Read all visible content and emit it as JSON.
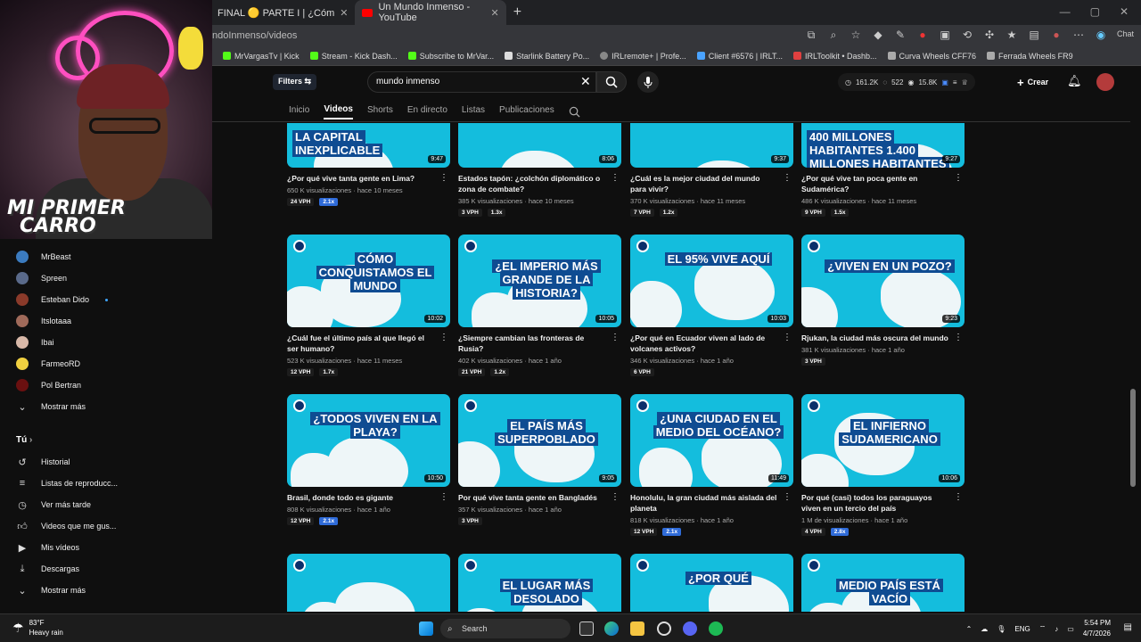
{
  "browser": {
    "tabs": [
      {
        "label": "FINAL 🟡 PARTE I | ¿Cóm",
        "close": "✕"
      },
      {
        "label": "Un Mundo Inmenso - YouTube",
        "close": "✕"
      }
    ],
    "new_tab": "+",
    "url": "ndoInmenso/videos",
    "chat_label": "Chat",
    "bookmarks": [
      "MrVargasTv | Kick",
      "Stream - Kick Dash...",
      "Subscribe to MrVar...",
      "Starlink Battery Po...",
      "IRLremote+ | Profe...",
      "Client #6576 | IRLT...",
      "IRLToolkit • Dashb...",
      "Curva Wheels CFF76",
      "Ferrada Wheels FR9"
    ]
  },
  "header": {
    "filters_label": "Filters",
    "search_value": "mundo inmenso",
    "clear": "✕",
    "stats": {
      "a": "161.2K",
      "b": "522",
      "c": "15.8K"
    },
    "create_label": "Crear"
  },
  "channel_tabs": [
    "Inicio",
    "Videos",
    "Shorts",
    "En directo",
    "Listas",
    "Publicaciones"
  ],
  "sidebar": {
    "subs": [
      {
        "label": "MrBeast",
        "color": "#3b7bbf"
      },
      {
        "label": "Spreen",
        "color": "#5a6a8a"
      },
      {
        "label": "Esteban Dido",
        "color": "#8a3a2a"
      },
      {
        "label": "Itslotaaa",
        "color": "#a06a5a"
      },
      {
        "label": "Ibai",
        "color": "#d8b8a8"
      },
      {
        "label": "FarmeoRD",
        "color": "#f0d040"
      },
      {
        "label": "Pol Bertran",
        "color": "#6a1010"
      }
    ],
    "show_more": "Mostrar más",
    "you_label": "Tú",
    "you_items": [
      "Historial",
      "Listas de reproducc...",
      "Ver más tarde",
      "Videos que me gus...",
      "Mis vídeos",
      "Descargas",
      "Mostrar más"
    ]
  },
  "webcam": {
    "overlay_line1": "MI PRIMER",
    "overlay_line2": "CARRO"
  },
  "videos": [
    {
      "thumb_text": "LA CAPITAL INEXPLICABLE",
      "duration": "9:47",
      "title": "¿Por qué vive tanta gente en Lima?",
      "views": "650 K visualizaciones",
      "age": "hace 10 meses",
      "chips": [
        "24 VPH",
        "2.1x"
      ],
      "blue": 1
    },
    {
      "thumb_text": "",
      "duration": "8:06",
      "title": "Estados tapón: ¿colchón diplomático o zona de combate?",
      "views": "385 K visualizaciones",
      "age": "hace 10 meses",
      "chips": [
        "3 VPH",
        "1.3x"
      ],
      "blue": -1
    },
    {
      "thumb_text": "",
      "duration": "9:37",
      "title": "¿Cuál es la mejor ciudad del mundo para vivir?",
      "views": "370 K visualizaciones",
      "age": "hace 11 meses",
      "chips": [
        "7 VPH",
        "1.2x"
      ],
      "blue": -1
    },
    {
      "thumb_text": "400 MILLONES HABITANTES    1.400 MILLONES HABITANTES",
      "duration": "9:27",
      "title": "¿Por qué vive tan poca gente en Sudamérica?",
      "views": "486 K visualizaciones",
      "age": "hace 11 meses",
      "chips": [
        "9 VPH",
        "1.5x"
      ],
      "blue": -1
    },
    {
      "thumb_text": "CÓMO CONQUISTAMOS EL MUNDO",
      "duration": "10:02",
      "title": "¿Cuál fue el último país al que llegó el ser humano?",
      "views": "523 K visualizaciones",
      "age": "hace 11 meses",
      "chips": [
        "12 VPH",
        "1.7x"
      ],
      "blue": -1
    },
    {
      "thumb_text": "¿EL IMPERIO MÁS GRANDE DE LA HISTORIA?",
      "duration": "10:05",
      "title": "¿Siempre cambian las fronteras de Rusia?",
      "views": "402 K visualizaciones",
      "age": "hace 1 año",
      "chips": [
        "21 VPH",
        "1.2x"
      ],
      "blue": -1
    },
    {
      "thumb_text": "EL 95% VIVE AQUÍ",
      "duration": "10:03",
      "title": "¿Por qué en Ecuador viven al lado de volcanes activos?",
      "views": "346 K visualizaciones",
      "age": "hace 1 año",
      "chips": [
        "6 VPH"
      ],
      "blue": -1
    },
    {
      "thumb_text": "¿VIVEN EN UN POZO?",
      "duration": "9:23",
      "title": "Rjukan, la ciudad más oscura del mundo",
      "views": "381 K visualizaciones",
      "age": "hace 1 año",
      "chips": [
        "3 VPH"
      ],
      "blue": -1
    },
    {
      "thumb_text": "¿TODOS VIVEN EN LA PLAYA?",
      "duration": "10:50",
      "title": "Brasil, donde todo es gigante",
      "views": "808 K visualizaciones",
      "age": "hace 1 año",
      "chips": [
        "12 VPH",
        "2.1x"
      ],
      "blue": 1
    },
    {
      "thumb_text": "EL PAÍS MÁS SUPERPOBLADO",
      "duration": "9:05",
      "title": "Por qué vive tanta gente en Bangladés",
      "views": "357 K visualizaciones",
      "age": "hace 1 año",
      "chips": [
        "3 VPH"
      ],
      "blue": -1
    },
    {
      "thumb_text": "¿UNA CIUDAD EN EL MEDIO DEL OCÉANO?",
      "duration": "11:49",
      "title": "Honolulu, la gran ciudad más aislada del planeta",
      "views": "818 K visualizaciones",
      "age": "hace 1 año",
      "chips": [
        "12 VPH",
        "2.1x"
      ],
      "blue": 1
    },
    {
      "thumb_text": "EL INFIERNO SUDAMERICANO",
      "duration": "10:06",
      "title": "Por qué (casi) todos los paraguayos viven en un tercio del país",
      "views": "1 M de visualizaciones",
      "age": "hace 1 año",
      "chips": [
        "4 VPH",
        "2.8x"
      ],
      "blue": 1
    },
    {
      "thumb_text": "",
      "duration": "",
      "title": "",
      "views": "",
      "age": "",
      "chips": [],
      "blue": -1
    },
    {
      "thumb_text": "EL LUGAR MÁS DESOLADO",
      "duration": "",
      "title": "",
      "views": "",
      "age": "",
      "chips": [],
      "blue": -1
    },
    {
      "thumb_text": "¿POR QUÉ",
      "duration": "",
      "title": "",
      "views": "",
      "age": "",
      "chips": [],
      "blue": -1
    },
    {
      "thumb_text": "MEDIO PAÍS ESTÁ VACÍO",
      "duration": "",
      "title": "",
      "views": "",
      "age": "",
      "chips": [],
      "blue": -1
    }
  ],
  "taskbar": {
    "weather_temp": "83°F",
    "weather_desc": "Heavy rain",
    "search": "Search",
    "lang": "ENG",
    "time": "5:54 PM",
    "date": "4/7/2026"
  }
}
